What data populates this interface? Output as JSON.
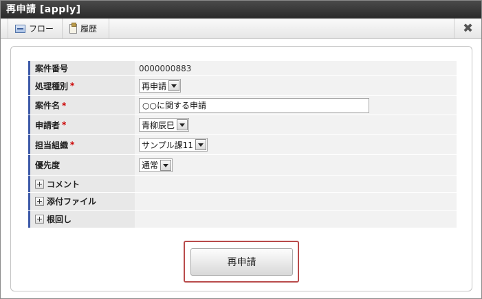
{
  "window": {
    "title": "再申請 [apply]"
  },
  "toolbar": {
    "flow_label": "フロー",
    "history_label": "履歴",
    "close_glyph": "✖"
  },
  "form": {
    "case_number": {
      "label": "案件番号",
      "value": "0000000883"
    },
    "process_type": {
      "label": "処理種別",
      "required_mark": "*",
      "selected": "再申請"
    },
    "case_name": {
      "label": "案件名",
      "required_mark": "*",
      "value": "○○に関する申請"
    },
    "applicant": {
      "label": "申請者",
      "required_mark": "*",
      "selected": "青柳辰巳"
    },
    "org": {
      "label": "担当組織",
      "required_mark": "*",
      "selected": "サンプル課11"
    },
    "priority": {
      "label": "優先度",
      "selected": "通常"
    },
    "comment": {
      "label": "コメント"
    },
    "attachments": {
      "label": "添付ファイル"
    },
    "nemawashi": {
      "label": "根回し"
    }
  },
  "submit": {
    "label": "再申請"
  },
  "icons": {
    "flow": "flow-icon",
    "history": "clipboard-icon",
    "close": "close-icon",
    "expand": "plus-icon"
  },
  "colors": {
    "label_accent": "#3d5aa8",
    "required": "#cc0000",
    "highlight": "#b84a4a"
  }
}
